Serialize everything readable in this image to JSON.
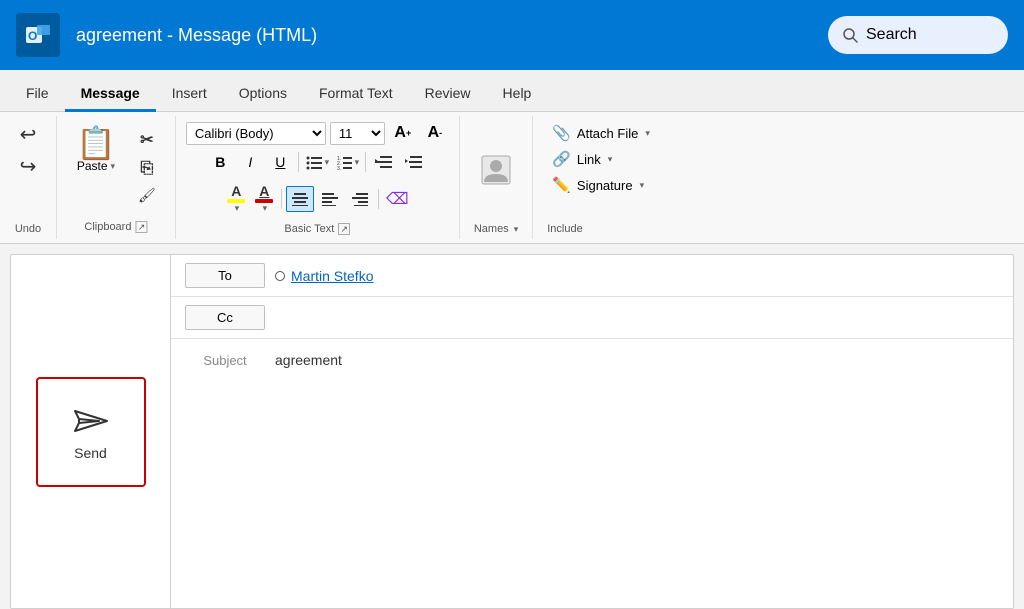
{
  "titlebar": {
    "title": "agreement  -  Message (HTML)",
    "search_placeholder": "Search"
  },
  "tabs": [
    {
      "label": "File",
      "active": false
    },
    {
      "label": "Message",
      "active": true
    },
    {
      "label": "Insert",
      "active": false
    },
    {
      "label": "Options",
      "active": false
    },
    {
      "label": "Format Text",
      "active": false
    },
    {
      "label": "Review",
      "active": false
    },
    {
      "label": "Help",
      "active": false
    }
  ],
  "ribbon": {
    "undo_label": "Undo",
    "clipboard_label": "Clipboard",
    "paste_label": "Paste",
    "font_name": "Calibri (Body)",
    "font_size": "11",
    "basic_text_label": "Basic Text",
    "names_label": "Names",
    "include_label": "Include",
    "attach_file_label": "Attach File",
    "link_label": "Link",
    "signature_label": "Signature"
  },
  "compose": {
    "to_label": "To",
    "cc_label": "Cc",
    "subject_label": "Subject",
    "recipient": "Martin Stefko",
    "subject_value": "agreement",
    "send_label": "Send"
  }
}
